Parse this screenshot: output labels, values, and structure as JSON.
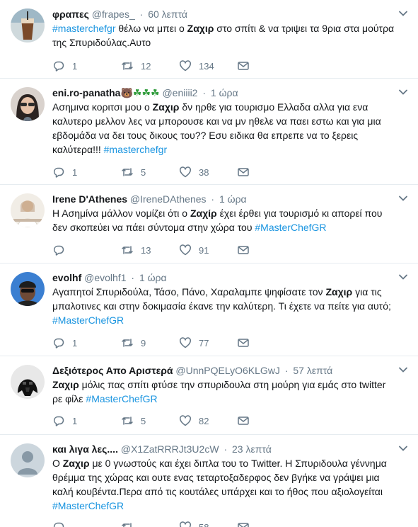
{
  "tweets": [
    {
      "name": "φραπες",
      "handle": "@frapes_",
      "time": "60 λεπτά",
      "lines": [
        [
          {
            "t": "#masterchefgr",
            "c": "tag"
          },
          {
            "t": " θέλω να μπει ο "
          },
          {
            "t": "Ζαχιρ",
            "c": "kw"
          },
          {
            "t": " στο σπίτι & να τριψει τα 9ρια στα μούτρα"
          }
        ],
        [
          {
            "t": "της Σπυριδούλας.Αυτο"
          }
        ]
      ],
      "replies": "1",
      "retweets": "12",
      "likes": "134",
      "avatar": "frappe-avatar"
    },
    {
      "name": "eni.ro-panatha",
      "name_emoji": "🐻☘☘☘",
      "handle": "@eniiii2",
      "time": "1 ώρα",
      "lines": [
        [
          {
            "t": "Ασημινα κοριτσι μου ο "
          },
          {
            "t": "Ζαχιρ",
            "c": "kw"
          },
          {
            "t": " δν ηρθε για τουρισμο Ελλαδα αλλα για ενα"
          }
        ],
        [
          {
            "t": "καλυτερο μελλον λες να μπορουσε και να μν ηθελε να παει εστω και για μια"
          }
        ],
        [
          {
            "t": "εβδομάδα να δει τους δικους του?? Εσυ ειδικα θα επρεπε να το ξερεις"
          }
        ],
        [
          {
            "t": "καλύτερα!!! "
          },
          {
            "t": "#masterchefgr",
            "c": "tag"
          }
        ]
      ],
      "replies": "1",
      "retweets": "5",
      "likes": "38",
      "avatar": "woman-sunglasses-avatar"
    },
    {
      "name": "Irene D'Athenes",
      "handle": "@IreneDAthenes",
      "time": "1 ώρα",
      "lines": [
        [
          {
            "t": "Η Ασημίνα μάλλον νομίζει ότι ο "
          },
          {
            "t": "Ζαχίρ",
            "c": "kw"
          },
          {
            "t": " έχει έρθει για τουρισμό κι απορεί που"
          }
        ],
        [
          {
            "t": "δεν σκοπεύει να πάει σύντομα στην χώρα του "
          },
          {
            "t": "#MasterChefGR",
            "c": "tag"
          }
        ]
      ],
      "replies": "",
      "retweets": "13",
      "likes": "91",
      "avatar": "woman-bright-avatar"
    },
    {
      "name": "evolhf",
      "handle": "@evolhf1",
      "time": "1 ώρα",
      "lines": [
        [
          {
            "t": "Αγαπητοί Σπυριδούλα, Τάσο, Πάνο, Χαραλαμπε ψηφίσατε τον "
          },
          {
            "t": "Ζαχιρ",
            "c": "kw"
          },
          {
            "t": " για τις"
          }
        ],
        [
          {
            "t": "μπαλοτινες και στην δοκιμασία έκανε την καλύτερη. Τι έχετε να πείτε για αυτό;"
          }
        ],
        [
          {
            "t": "#MasterChefGR",
            "c": "tag"
          }
        ]
      ],
      "replies": "1",
      "retweets": "9",
      "likes": "77",
      "avatar": "man-cap-avatar"
    },
    {
      "name": "Δεξιότερος Απο Αριστερά",
      "handle": "@UnnPQELyO6KLGwJ",
      "time": "57 λεπτά",
      "lines": [
        [
          {
            "t": "Ζαχιρ",
            "c": "kw"
          },
          {
            "t": " μόλις πας σπίτι φτύσε την σπυριδουλα στη μούρη για εμάς στο twitter"
          }
        ],
        [
          {
            "t": "ρε φίλε "
          },
          {
            "t": "#MasterChefGR",
            "c": "tag"
          }
        ]
      ],
      "replies": "1",
      "retweets": "5",
      "likes": "82",
      "avatar": "darth-vader-avatar"
    },
    {
      "name": "και λιγα λες....",
      "handle": "@X1ZatRRRJt3U2cW",
      "time": "23 λεπτά",
      "lines": [
        [
          {
            "t": "Ο "
          },
          {
            "t": "Ζαχιρ",
            "c": "kw"
          },
          {
            "t": " με 0 γνωστούς και έχει διπλα του το Twitter. Η Σπυριδουλα γέννημα"
          }
        ],
        [
          {
            "t": "θρέμμα της χώρας και ουτε ενας τεταρτοξαδερφος δεν βγήκε να γράψει μια"
          }
        ],
        [
          {
            "t": "καλή κουβέντα.Περα από τις  κουτάλες υπάρχει και το ήθος που αξιολογείται"
          }
        ],
        [
          {
            "t": "#MasterChefGR",
            "c": "tag"
          }
        ]
      ],
      "replies": "",
      "retweets": "",
      "likes": "58",
      "avatar": "default-avatar"
    }
  ],
  "icons": {
    "reply": "reply-icon",
    "retweet": "retweet-icon",
    "like": "like-icon",
    "dm": "direct-message-icon",
    "caret": "chevron-down-icon"
  },
  "colors": {
    "text": "#14171a",
    "secondary": "#657786",
    "hashtag": "#1b95e0",
    "divider": "#e6ecf0"
  }
}
